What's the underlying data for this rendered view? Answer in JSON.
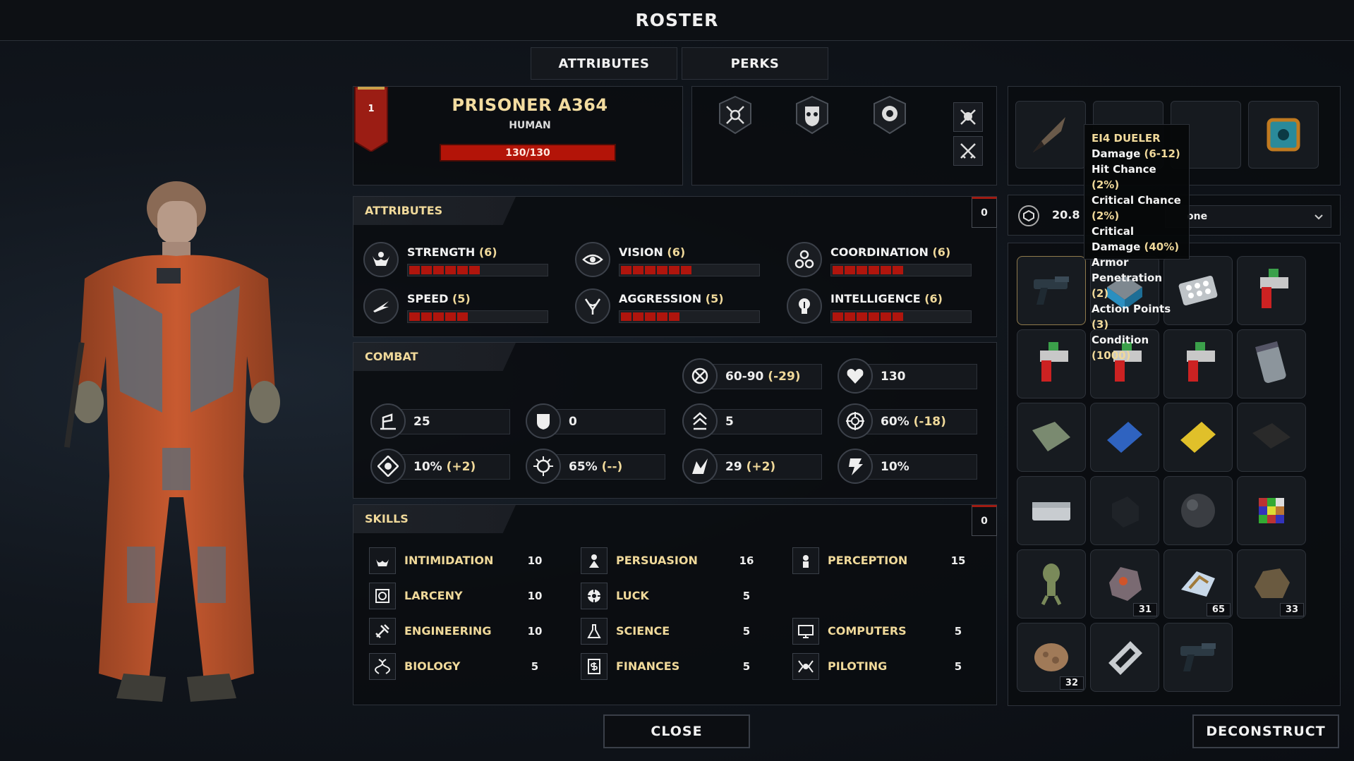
{
  "title": "ROSTER",
  "tabs": [
    {
      "label": "ATTRIBUTES"
    },
    {
      "label": "PERKS"
    }
  ],
  "character": {
    "level": "1",
    "name": "PRISONER A364",
    "race": "HUMAN",
    "hp_text": "130/130",
    "hp_fraction": 1.0
  },
  "attributes": {
    "header": "ATTRIBUTES",
    "points": "0",
    "items": [
      {
        "name": "STRENGTH",
        "value": "(6)",
        "icon": "strength-icon",
        "level": 6
      },
      {
        "name": "VISION",
        "value": "(6)",
        "icon": "eye-icon",
        "level": 6
      },
      {
        "name": "COORDINATION",
        "value": "(6)",
        "icon": "coordination-icon",
        "level": 6
      },
      {
        "name": "SPEED",
        "value": "(5)",
        "icon": "speed-icon",
        "level": 5
      },
      {
        "name": "AGGRESSION",
        "value": "(5)",
        "icon": "aggression-icon",
        "level": 5
      },
      {
        "name": "INTELLIGENCE",
        "value": "(6)",
        "icon": "intelligence-icon",
        "level": 6
      }
    ]
  },
  "combat": {
    "header": "COMBAT",
    "stats": [
      {
        "icon": "damage-icon",
        "value": "60-90",
        "mod": "(-29)"
      },
      {
        "icon": "health-icon",
        "value": "130",
        "mod": ""
      },
      {
        "icon": "move-icon",
        "value": "25",
        "mod": ""
      },
      {
        "icon": "armor-icon",
        "value": "0",
        "mod": ""
      },
      {
        "icon": "action-points-icon",
        "value": "5",
        "mod": ""
      },
      {
        "icon": "hit-chance-icon",
        "value": "60%",
        "mod": "(-18)"
      },
      {
        "icon": "crit-chance-icon",
        "value": "10%",
        "mod": "(+2)"
      },
      {
        "icon": "crit-damage-icon",
        "value": "65%",
        "mod": "(--)"
      },
      {
        "icon": "dodge-icon",
        "value": "29",
        "mod": "(+2)"
      },
      {
        "icon": "resist-icon",
        "value": "10%",
        "mod": ""
      }
    ]
  },
  "skills": {
    "header": "SKILLS",
    "points": "0",
    "items": [
      {
        "name": "INTIMIDATION",
        "value": "10",
        "icon": "intimidation-icon"
      },
      {
        "name": "PERSUASION",
        "value": "16",
        "icon": "persuasion-icon"
      },
      {
        "name": "PERCEPTION",
        "value": "15",
        "icon": "perception-icon"
      },
      {
        "name": "LARCENY",
        "value": "10",
        "icon": "larceny-icon"
      },
      {
        "name": "LUCK",
        "value": "5",
        "icon": "luck-icon"
      },
      {
        "name": "ENGINEERING",
        "value": "10",
        "icon": "engineering-icon"
      },
      {
        "name": "SCIENCE",
        "value": "5",
        "icon": "science-icon"
      },
      {
        "name": "COMPUTERS",
        "value": "5",
        "icon": "computer-icon"
      },
      {
        "name": "BIOLOGY",
        "value": "5",
        "icon": "dna-icon"
      },
      {
        "name": "FINANCES",
        "value": "5",
        "icon": "finances-icon"
      },
      {
        "name": "PILOTING",
        "value": "5",
        "icon": "piloting-icon"
      }
    ]
  },
  "equipment": {
    "weight": "20.8",
    "dropdown_partial": "one"
  },
  "tooltip": {
    "title": "EI4 DUELER",
    "lines": [
      {
        "label": "Damage",
        "value": "(6-12)"
      },
      {
        "label": "Hit Chance",
        "value": "(2%)"
      },
      {
        "label": "Critical Chance",
        "value": "(2%)"
      },
      {
        "label": "Critical Damage",
        "value": "(40%)"
      },
      {
        "label": "Armor Penetration",
        "value": "(2)"
      },
      {
        "label": "Action Points",
        "value": "(3)"
      },
      {
        "label": "Condition",
        "value": "(1000)"
      }
    ]
  },
  "inventory": {
    "counts": {
      "meteor1": "31",
      "crystals": "65",
      "rock": "33",
      "ore": "32"
    }
  },
  "buttons": {
    "close": "CLOSE",
    "deconstruct": "DECONSTRUCT"
  },
  "colors": {
    "accent": "#f0d99a",
    "health": "#b31408",
    "panel": "#0a0c10"
  }
}
